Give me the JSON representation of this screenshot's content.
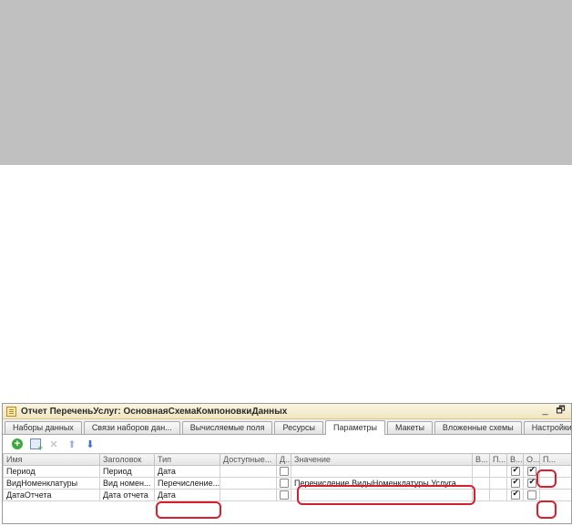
{
  "window": {
    "title": "Отчет ПереченьУслуг: ОсновнаяСхемаКомпоновкиДанных",
    "minimize_glyph": "_",
    "restore_glyph": "🗗"
  },
  "tabs": [
    {
      "label": "Наборы данных"
    },
    {
      "label": "Связи наборов дан..."
    },
    {
      "label": "Вычисляемые поля"
    },
    {
      "label": "Ресурсы"
    },
    {
      "label": "Параметры",
      "active": true
    },
    {
      "label": "Макеты"
    },
    {
      "label": "Вложенные схемы"
    },
    {
      "label": "Настройки"
    }
  ],
  "toolbar": {
    "icons": [
      "add-icon",
      "copy-icon",
      "delete-icon",
      "move-up-icon",
      "move-down-icon"
    ],
    "add_glyph": "+",
    "delete_glyph": "✕",
    "up_glyph": "⬆",
    "down_glyph": "⬇"
  },
  "grid": {
    "columns": [
      "Имя",
      "Заголовок",
      "Тип",
      "Доступные...",
      "Д...",
      "Значение",
      "В...",
      "П...",
      "В...",
      "О...",
      "П..."
    ],
    "rows": [
      {
        "name": "Период",
        "title": "Период",
        "type": "Дата",
        "available": "",
        "d": false,
        "value": "",
        "v1": "",
        "p1": "",
        "v2": true,
        "o": true
      },
      {
        "name": "ВидНоменклатуры",
        "title": "Вид номен...",
        "type": "Перечисление...",
        "available": "",
        "d": false,
        "value": "Перечисление.ВидыНоменклатуры.Услуга",
        "v1": "",
        "p1": "",
        "v2": true,
        "o": true
      },
      {
        "name": "ДатаОтчета",
        "title": "Дата отчета",
        "type": "Дата",
        "available": "",
        "d": false,
        "value": "",
        "v1": "",
        "p1": "",
        "v2": true,
        "o": false
      }
    ]
  },
  "colors": {
    "banner": "#c0c0c0",
    "annotation": "#d6202d",
    "add_icon": "#3fa83f",
    "arrow_icon": "#3d72c4"
  }
}
